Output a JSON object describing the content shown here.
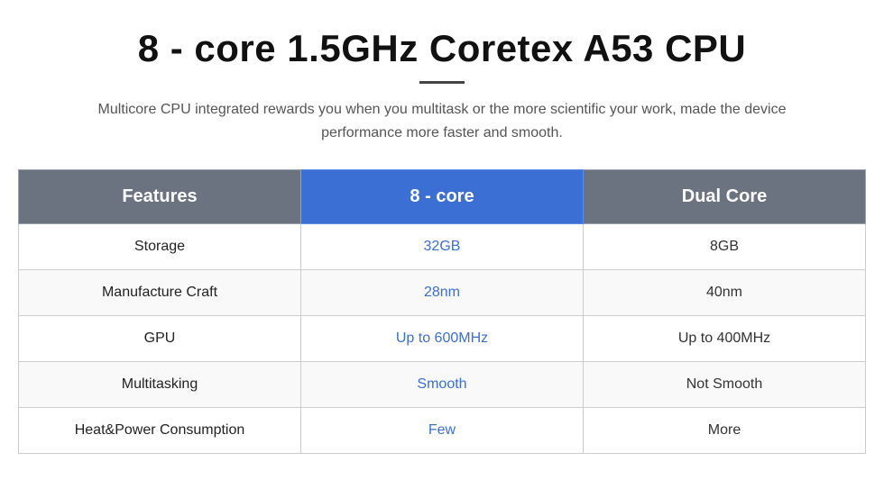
{
  "header": {
    "title": "8 - core 1.5GHz Coretex A53 CPU",
    "subtitle": "Multicore CPU integrated rewards you when you multitask or the more scientific your work, made the device performance more faster and smooth."
  },
  "table": {
    "columns": {
      "features": "Features",
      "eight_core": "8 - core",
      "dual_core": "Dual Core"
    },
    "rows": [
      {
        "feature": "Storage",
        "eight_core_value": "32GB",
        "dual_core_value": "8GB"
      },
      {
        "feature": "Manufacture Craft",
        "eight_core_value": "28nm",
        "dual_core_value": "40nm"
      },
      {
        "feature": "GPU",
        "eight_core_value": "Up to 600MHz",
        "dual_core_value": "Up to 400MHz"
      },
      {
        "feature": "Multitasking",
        "eight_core_value": "Smooth",
        "dual_core_value": "Not Smooth"
      },
      {
        "feature": "Heat&Power Consumption",
        "eight_core_value": "Few",
        "dual_core_value": "More"
      }
    ]
  }
}
